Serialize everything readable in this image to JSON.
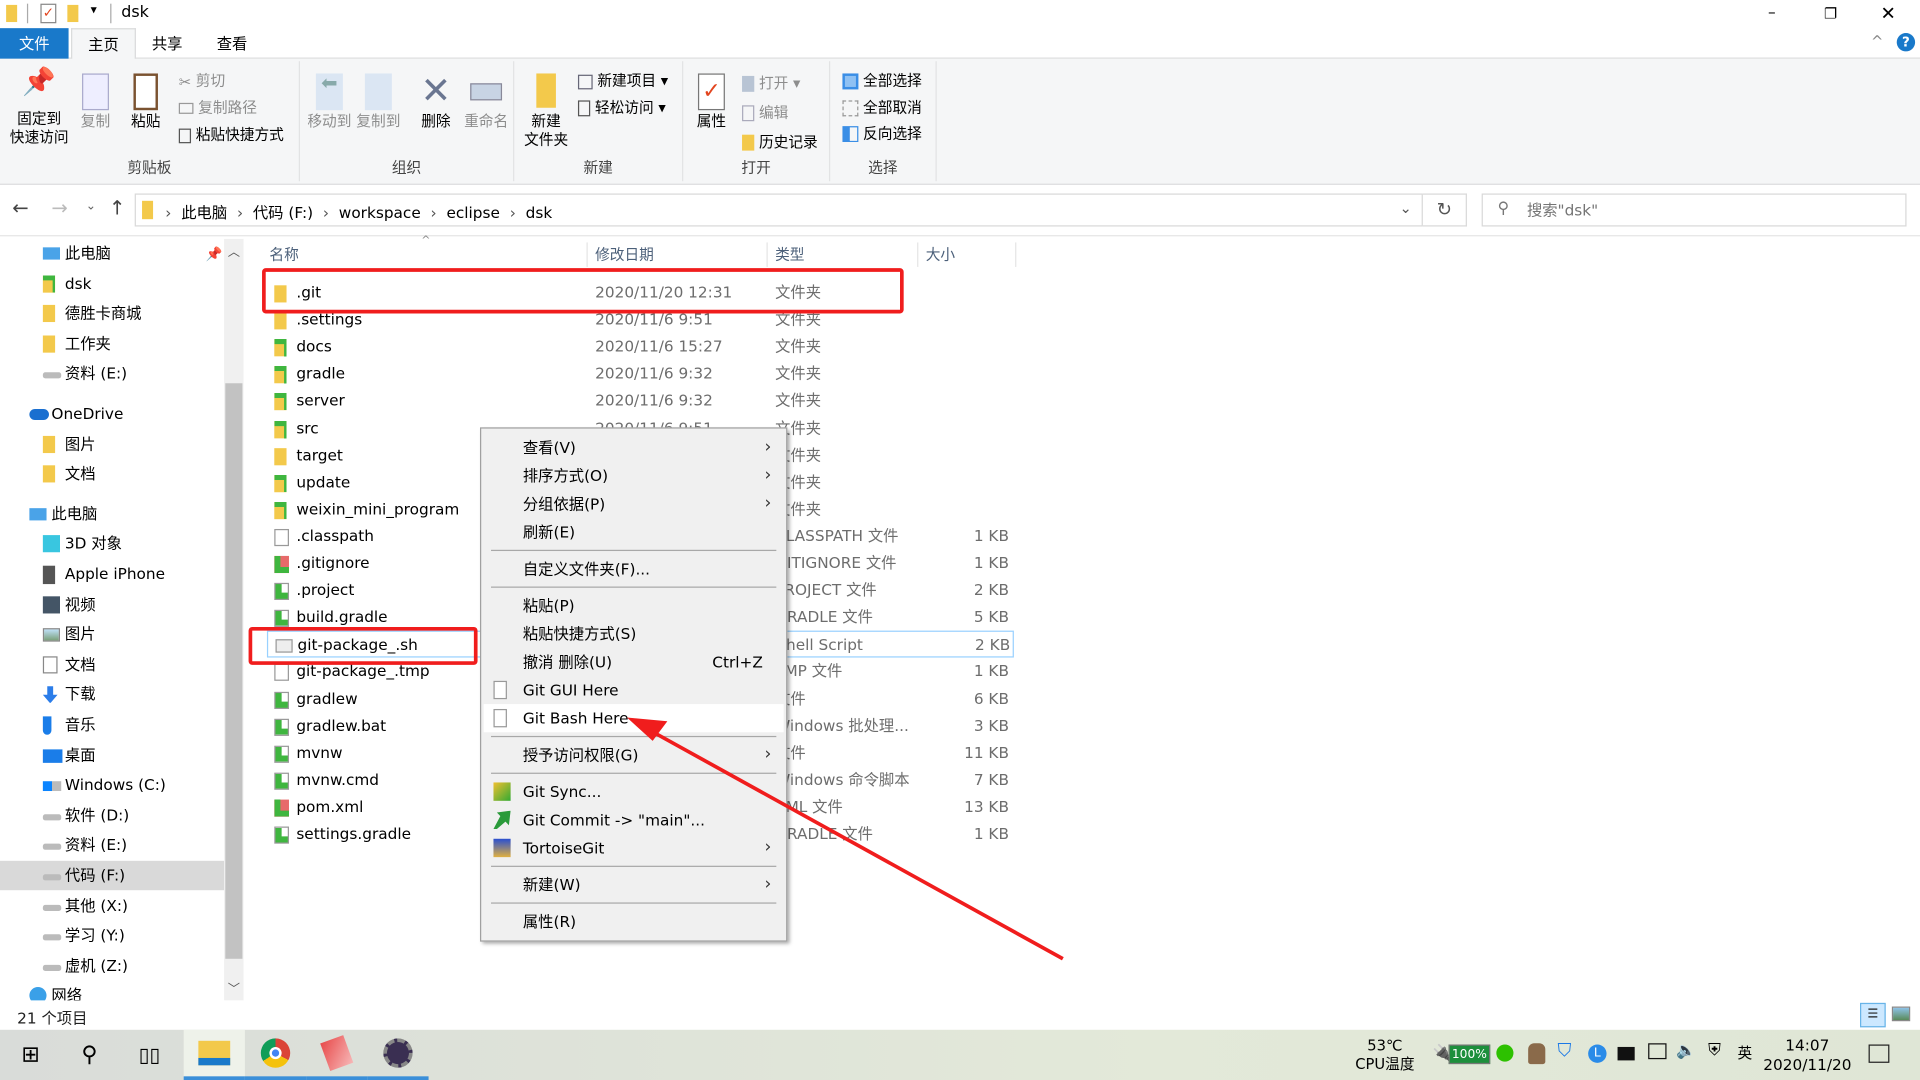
{
  "window": {
    "title": "dsk"
  },
  "tabs": [
    {
      "label": "文件"
    },
    {
      "label": "主页"
    },
    {
      "label": "共享"
    },
    {
      "label": "查看"
    }
  ],
  "ribbon": {
    "clipboard": {
      "label": "剪贴板",
      "pin": "固定到\n快速访问",
      "copy": "复制",
      "paste": "粘贴",
      "cut": "剪切",
      "copy_path": "复制路径",
      "paste_shortcut": "粘贴快捷方式"
    },
    "organize": {
      "label": "组织",
      "move_to": "移动到",
      "copy_to": "复制到",
      "delete": "删除",
      "rename": "重命名"
    },
    "new": {
      "label": "新建",
      "new_folder": "新建\n文件夹",
      "new_item": "新建项目",
      "easy_access": "轻松访问"
    },
    "open": {
      "label": "打开",
      "properties": "属性",
      "open": "打开",
      "edit": "编辑",
      "history": "历史记录"
    },
    "select": {
      "label": "选择",
      "select_all": "全部选择",
      "select_none": "全部取消",
      "invert": "反向选择"
    }
  },
  "address": {
    "crumbs": [
      "此电脑",
      "代码 (F:)",
      "workspace",
      "eclipse",
      "dsk"
    ],
    "search_placeholder": "搜索\"dsk\""
  },
  "nav": [
    {
      "label": "此电脑",
      "icon": "pc",
      "indent": 1
    },
    {
      "label": "dsk",
      "icon": "gitfolder",
      "indent": 1
    },
    {
      "label": "德胜卡商城",
      "icon": "folder",
      "indent": 1
    },
    {
      "label": "工作夹",
      "icon": "folder",
      "indent": 1
    },
    {
      "label": "资料 (E:)",
      "icon": "drive",
      "indent": 1
    },
    {
      "label": "OneDrive",
      "icon": "cloud",
      "indent": 0,
      "gap": true
    },
    {
      "label": "图片",
      "icon": "folder",
      "indent": 1
    },
    {
      "label": "文档",
      "icon": "folder",
      "indent": 1
    },
    {
      "label": "此电脑",
      "icon": "pc",
      "indent": 0,
      "gap": true
    },
    {
      "label": "3D 对象",
      "icon": "cube",
      "indent": 1
    },
    {
      "label": "Apple iPhone",
      "icon": "phone",
      "indent": 1
    },
    {
      "label": "视频",
      "icon": "video",
      "indent": 1
    },
    {
      "label": "图片",
      "icon": "picture",
      "indent": 1
    },
    {
      "label": "文档",
      "icon": "doc",
      "indent": 1
    },
    {
      "label": "下载",
      "icon": "download",
      "indent": 1
    },
    {
      "label": "音乐",
      "icon": "music",
      "indent": 1
    },
    {
      "label": "桌面",
      "icon": "desktop",
      "indent": 1
    },
    {
      "label": "Windows (C:)",
      "icon": "windrive",
      "indent": 1
    },
    {
      "label": "软件 (D:)",
      "icon": "drive",
      "indent": 1
    },
    {
      "label": "资料 (E:)",
      "icon": "drive",
      "indent": 1
    },
    {
      "label": "代码 (F:)",
      "icon": "drive",
      "indent": 1,
      "selected": true
    },
    {
      "label": "其他 (X:)",
      "icon": "drive",
      "indent": 1
    },
    {
      "label": "学习 (Y:)",
      "icon": "drive",
      "indent": 1
    },
    {
      "label": "虚机 (Z:)",
      "icon": "drive",
      "indent": 1
    },
    {
      "label": "网络",
      "icon": "network",
      "indent": 0
    }
  ],
  "columns": {
    "name": "名称",
    "date": "修改日期",
    "type": "类型",
    "size": "大小"
  },
  "files": [
    {
      "name": ".git",
      "date": "2020/11/20 12:31",
      "type": "文件夹",
      "size": "",
      "icon": "folder"
    },
    {
      "name": ".settings",
      "date": "2020/11/6 9:51",
      "type": "文件夹",
      "size": "",
      "icon": "folder"
    },
    {
      "name": "docs",
      "date": "2020/11/6 15:27",
      "type": "文件夹",
      "size": "",
      "icon": "gitfolder"
    },
    {
      "name": "gradle",
      "date": "2020/11/6 9:32",
      "type": "文件夹",
      "size": "",
      "icon": "gitfolder"
    },
    {
      "name": "server",
      "date": "2020/11/6 9:32",
      "type": "文件夹",
      "size": "",
      "icon": "gitfolder"
    },
    {
      "name": "src",
      "date": "2020/11/6 9:51",
      "type": "文件夹",
      "size": "",
      "icon": "gitfolder"
    },
    {
      "name": "target",
      "date": "",
      "type": "文件夹",
      "size": "",
      "icon": "folder"
    },
    {
      "name": "update",
      "date": "",
      "type": "文件夹",
      "size": "",
      "icon": "gitfolder"
    },
    {
      "name": "weixin_mini_program",
      "date": "",
      "type": "文件夹",
      "size": "",
      "icon": "gitfolder"
    },
    {
      "name": ".classpath",
      "date": "",
      "type": "CLASSPATH 文件",
      "size": "1 KB",
      "icon": "file"
    },
    {
      "name": ".gitignore",
      "date": "",
      "type": "GITIGNORE 文件",
      "size": "1 KB",
      "icon": "gitadd"
    },
    {
      "name": ".project",
      "date": "",
      "type": "PROJECT 文件",
      "size": "2 KB",
      "icon": "gitfile"
    },
    {
      "name": "build.gradle",
      "date": "",
      "type": "GRADLE 文件",
      "size": "5 KB",
      "icon": "gitfile"
    },
    {
      "name": "git-package_.sh",
      "date": "",
      "type": "Shell Script",
      "size": "2 KB",
      "icon": "script",
      "selected": true
    },
    {
      "name": "git-package_.tmp",
      "date": "",
      "type": "TMP 文件",
      "size": "1 KB",
      "icon": "file"
    },
    {
      "name": "gradlew",
      "date": "",
      "type": "文件",
      "size": "6 KB",
      "icon": "gitfile"
    },
    {
      "name": "gradlew.bat",
      "date": "",
      "type": "Windows 批处理...",
      "size": "3 KB",
      "icon": "gitfile"
    },
    {
      "name": "mvnw",
      "date": "",
      "type": "文件",
      "size": "11 KB",
      "icon": "gitfile"
    },
    {
      "name": "mvnw.cmd",
      "date": "",
      "type": "Windows 命令脚本",
      "size": "7 KB",
      "icon": "gitfile"
    },
    {
      "name": "pom.xml",
      "date": "",
      "type": "XML 文件",
      "size": "13 KB",
      "icon": "gitadd"
    },
    {
      "name": "settings.gradle",
      "date": "",
      "type": "GRADLE 文件",
      "size": "1 KB",
      "icon": "gitfile"
    }
  ],
  "context_menu": [
    {
      "label": "查看(V)",
      "submenu": true
    },
    {
      "label": "排序方式(O)",
      "submenu": true
    },
    {
      "label": "分组依据(P)",
      "submenu": true
    },
    {
      "label": "刷新(E)"
    },
    {
      "sep": true
    },
    {
      "label": "自定义文件夹(F)..."
    },
    {
      "sep": true
    },
    {
      "label": "粘贴(P)"
    },
    {
      "label": "粘贴快捷方式(S)"
    },
    {
      "label": "撤消 删除(U)",
      "shortcut": "Ctrl+Z"
    },
    {
      "label": "Git GUI Here",
      "icon": "page"
    },
    {
      "label": "Git Bash Here",
      "icon": "page",
      "highlighted": true
    },
    {
      "sep": true
    },
    {
      "label": "授予访问权限(G)",
      "submenu": true
    },
    {
      "sep": true
    },
    {
      "label": "Git Sync...",
      "icon": "sync"
    },
    {
      "label": "Git Commit -> \"main\"...",
      "icon": "commit"
    },
    {
      "label": "TortoiseGit",
      "icon": "tortoise",
      "submenu": true
    },
    {
      "sep": true
    },
    {
      "label": "新建(W)",
      "submenu": true
    },
    {
      "sep": true
    },
    {
      "label": "属性(R)"
    }
  ],
  "status": {
    "count": "21 个项目"
  },
  "taskbar": {
    "cpu_temp": "53℃",
    "cpu_label": "CPU温度",
    "battery": "100%",
    "time": "14:07",
    "date": "2020/11/20",
    "ime": "英"
  },
  "colors": {
    "accent": "#1979ca",
    "annotation": "#f01d1d",
    "selection": "#99d1ff"
  }
}
